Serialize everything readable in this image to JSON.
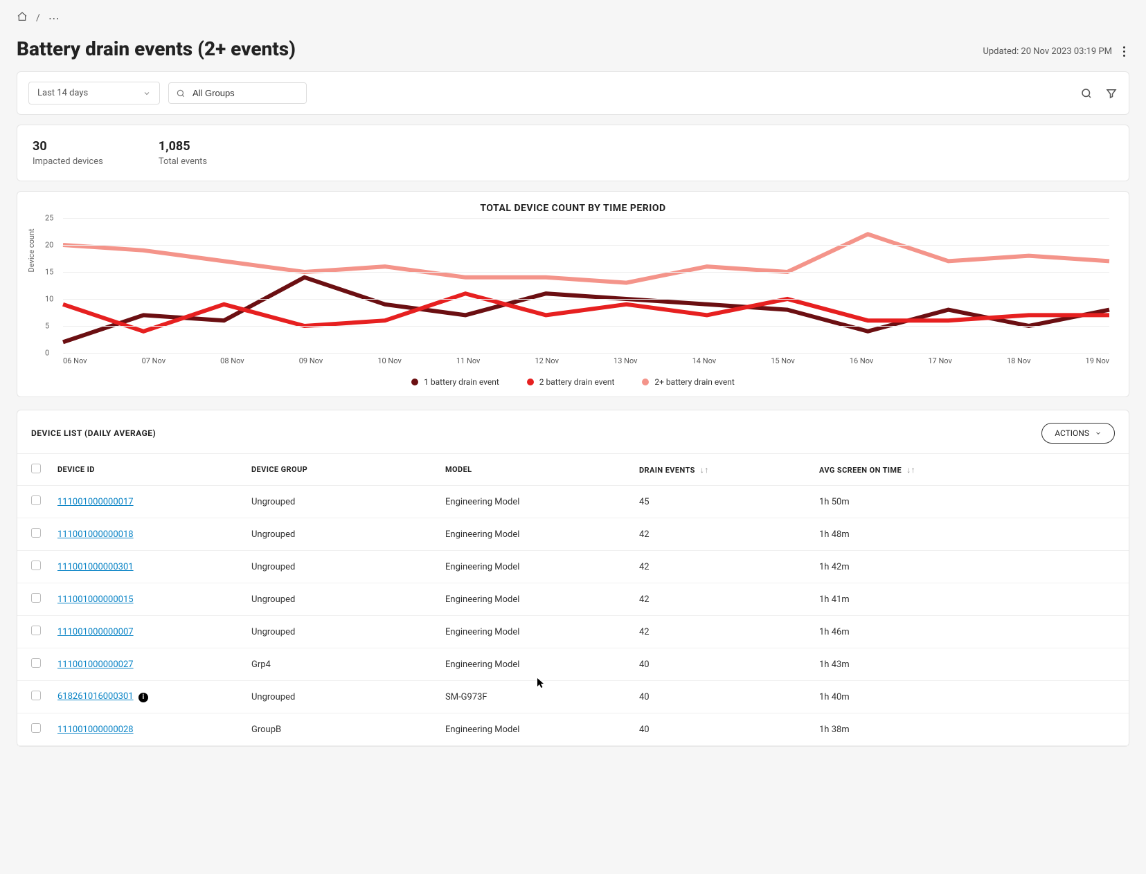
{
  "breadcrumb": {
    "sep": "/",
    "ellipsis": "⋯"
  },
  "title": "Battery drain events (2+ events)",
  "updated_label": "Updated: 20 Nov 2023 03:19 PM",
  "filters": {
    "date_range": "Last 14 days",
    "group_search_value": "All Groups"
  },
  "stats": {
    "impacted_value": "30",
    "impacted_label": "Impacted devices",
    "total_value": "1,085",
    "total_label": "Total events"
  },
  "chart_data": {
    "type": "line",
    "title": "TOTAL DEVICE COUNT BY TIME PERIOD",
    "ylabel": "Device count",
    "xlabel": "",
    "ylim": [
      0,
      25
    ],
    "yticks": [
      0,
      5,
      10,
      15,
      20,
      25
    ],
    "categories": [
      "06 Nov",
      "07 Nov",
      "08 Nov",
      "09 Nov",
      "10 Nov",
      "11 Nov",
      "12 Nov",
      "13 Nov",
      "14 Nov",
      "15 Nov",
      "16 Nov",
      "17 Nov",
      "18 Nov",
      "19 Nov"
    ],
    "series": [
      {
        "name": "1 battery drain event",
        "color": "#6b0f12",
        "values": [
          2,
          7,
          6,
          14,
          9,
          7,
          11,
          10,
          9,
          8,
          4,
          8,
          5,
          8
        ]
      },
      {
        "name": "2 battery drain event",
        "color": "#e62020",
        "values": [
          9,
          4,
          9,
          5,
          6,
          11,
          7,
          9,
          7,
          10,
          6,
          6,
          7,
          7
        ]
      },
      {
        "name": "2+ battery drain event",
        "color": "#f4948a",
        "values": [
          20,
          19,
          17,
          15,
          16,
          14,
          14,
          13,
          16,
          15,
          22,
          17,
          18,
          17
        ]
      }
    ]
  },
  "legend": {
    "s1": "1 battery drain event",
    "s2": "2 battery drain event",
    "s3": "2+ battery drain event"
  },
  "list": {
    "title": "DEVICE LIST (DAILY AVERAGE)",
    "actions_label": "ACTIONS",
    "columns": {
      "id": "DEVICE ID",
      "group": "DEVICE GROUP",
      "model": "MODEL",
      "drain": "DRAIN EVENTS",
      "screen": "AVG SCREEN ON TIME"
    },
    "rows": [
      {
        "id": "111001000000017",
        "group": "Ungrouped",
        "model": "Engineering Model",
        "drain": "45",
        "screen": "1h 50m",
        "info": false
      },
      {
        "id": "111001000000018",
        "group": "Ungrouped",
        "model": "Engineering Model",
        "drain": "42",
        "screen": "1h 48m",
        "info": false
      },
      {
        "id": "111001000000301",
        "group": "Ungrouped",
        "model": "Engineering Model",
        "drain": "42",
        "screen": "1h 42m",
        "info": false
      },
      {
        "id": "111001000000015",
        "group": "Ungrouped",
        "model": "Engineering Model",
        "drain": "42",
        "screen": "1h 41m",
        "info": false
      },
      {
        "id": "111001000000007",
        "group": "Ungrouped",
        "model": "Engineering Model",
        "drain": "42",
        "screen": "1h 46m",
        "info": false
      },
      {
        "id": "111001000000027",
        "group": "Grp4",
        "model": "Engineering Model",
        "drain": "40",
        "screen": "1h 43m",
        "info": false
      },
      {
        "id": "618261016000301",
        "group": "Ungrouped",
        "model": "SM-G973F",
        "drain": "40",
        "screen": "1h 40m",
        "info": true
      },
      {
        "id": "111001000000028",
        "group": "GroupB",
        "model": "Engineering Model",
        "drain": "40",
        "screen": "1h 38m",
        "info": false
      }
    ]
  }
}
